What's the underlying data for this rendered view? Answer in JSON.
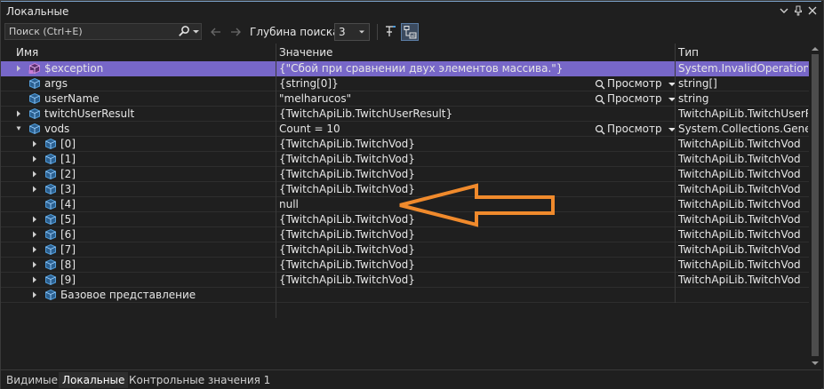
{
  "window": {
    "title": "Локальные"
  },
  "toolbar": {
    "search_placeholder": "Поиск (Ctrl+E)",
    "depth_label": "Глубина поиска:",
    "depth_value": "3"
  },
  "columns": {
    "name": "Имя",
    "value": "Значение",
    "type": "Тип"
  },
  "view_label": "Просмотр",
  "rows": [
    {
      "name": "$exception",
      "value": "{\"Сбой при сравнении двух элементов массива.\"}",
      "type": "System.InvalidOperationE...",
      "level": 0,
      "expandable": true,
      "selected": true,
      "view": false,
      "icon": "exception-icon"
    },
    {
      "name": "args",
      "value": "{string[0]}",
      "type": "string[]",
      "level": 0,
      "expandable": false,
      "selected": false,
      "view": true,
      "icon": "object-icon"
    },
    {
      "name": "userName",
      "value": "\"melharucos\"",
      "type": "string",
      "level": 0,
      "expandable": false,
      "selected": false,
      "view": true,
      "icon": "object-icon"
    },
    {
      "name": "twitchUserResult",
      "value": "{TwitchApiLib.TwitchUserResult}",
      "type": "TwitchApiLib.TwitchUserR...",
      "level": 0,
      "expandable": true,
      "selected": false,
      "view": false,
      "icon": "object-icon"
    },
    {
      "name": "vods",
      "value": "Count = 10",
      "type": "System.Collections.Gener...",
      "level": 0,
      "expandable": true,
      "expanded": true,
      "selected": false,
      "view": true,
      "icon": "object-icon"
    },
    {
      "name": "[0]",
      "value": "{TwitchApiLib.TwitchVod}",
      "type": "TwitchApiLib.TwitchVod",
      "level": 1,
      "expandable": true,
      "selected": false,
      "view": false,
      "icon": "object-icon"
    },
    {
      "name": "[1]",
      "value": "{TwitchApiLib.TwitchVod}",
      "type": "TwitchApiLib.TwitchVod",
      "level": 1,
      "expandable": true,
      "selected": false,
      "view": false,
      "icon": "object-icon"
    },
    {
      "name": "[2]",
      "value": "{TwitchApiLib.TwitchVod}",
      "type": "TwitchApiLib.TwitchVod",
      "level": 1,
      "expandable": true,
      "selected": false,
      "view": false,
      "icon": "object-icon"
    },
    {
      "name": "[3]",
      "value": "{TwitchApiLib.TwitchVod}",
      "type": "TwitchApiLib.TwitchVod",
      "level": 1,
      "expandable": true,
      "selected": false,
      "view": false,
      "icon": "object-icon"
    },
    {
      "name": "[4]",
      "value": "null",
      "type": "TwitchApiLib.TwitchVod",
      "level": 1,
      "expandable": false,
      "selected": false,
      "view": false,
      "icon": "object-icon"
    },
    {
      "name": "[5]",
      "value": "{TwitchApiLib.TwitchVod}",
      "type": "TwitchApiLib.TwitchVod",
      "level": 1,
      "expandable": true,
      "selected": false,
      "view": false,
      "icon": "object-icon"
    },
    {
      "name": "[6]",
      "value": "{TwitchApiLib.TwitchVod}",
      "type": "TwitchApiLib.TwitchVod",
      "level": 1,
      "expandable": true,
      "selected": false,
      "view": false,
      "icon": "object-icon"
    },
    {
      "name": "[7]",
      "value": "{TwitchApiLib.TwitchVod}",
      "type": "TwitchApiLib.TwitchVod",
      "level": 1,
      "expandable": true,
      "selected": false,
      "view": false,
      "icon": "object-icon"
    },
    {
      "name": "[8]",
      "value": "{TwitchApiLib.TwitchVod}",
      "type": "TwitchApiLib.TwitchVod",
      "level": 1,
      "expandable": true,
      "selected": false,
      "view": false,
      "icon": "object-icon"
    },
    {
      "name": "[9]",
      "value": "{TwitchApiLib.TwitchVod}",
      "type": "TwitchApiLib.TwitchVod",
      "level": 1,
      "expandable": true,
      "selected": false,
      "view": false,
      "icon": "object-icon"
    },
    {
      "name": "Базовое представление",
      "value": "",
      "type": "",
      "level": 1,
      "expandable": true,
      "selected": false,
      "view": false,
      "icon": "object-icon"
    }
  ],
  "tabs": [
    {
      "label": "Видимые",
      "active": false
    },
    {
      "label": "Локальные",
      "active": true
    },
    {
      "label": "Контрольные значения 1",
      "active": false
    }
  ],
  "colors": {
    "selected_row": "#7767c8",
    "object_icon": "#4f9bd9",
    "exception_icon": "#c77dd6",
    "annotation_arrow": "#f08a2c"
  }
}
